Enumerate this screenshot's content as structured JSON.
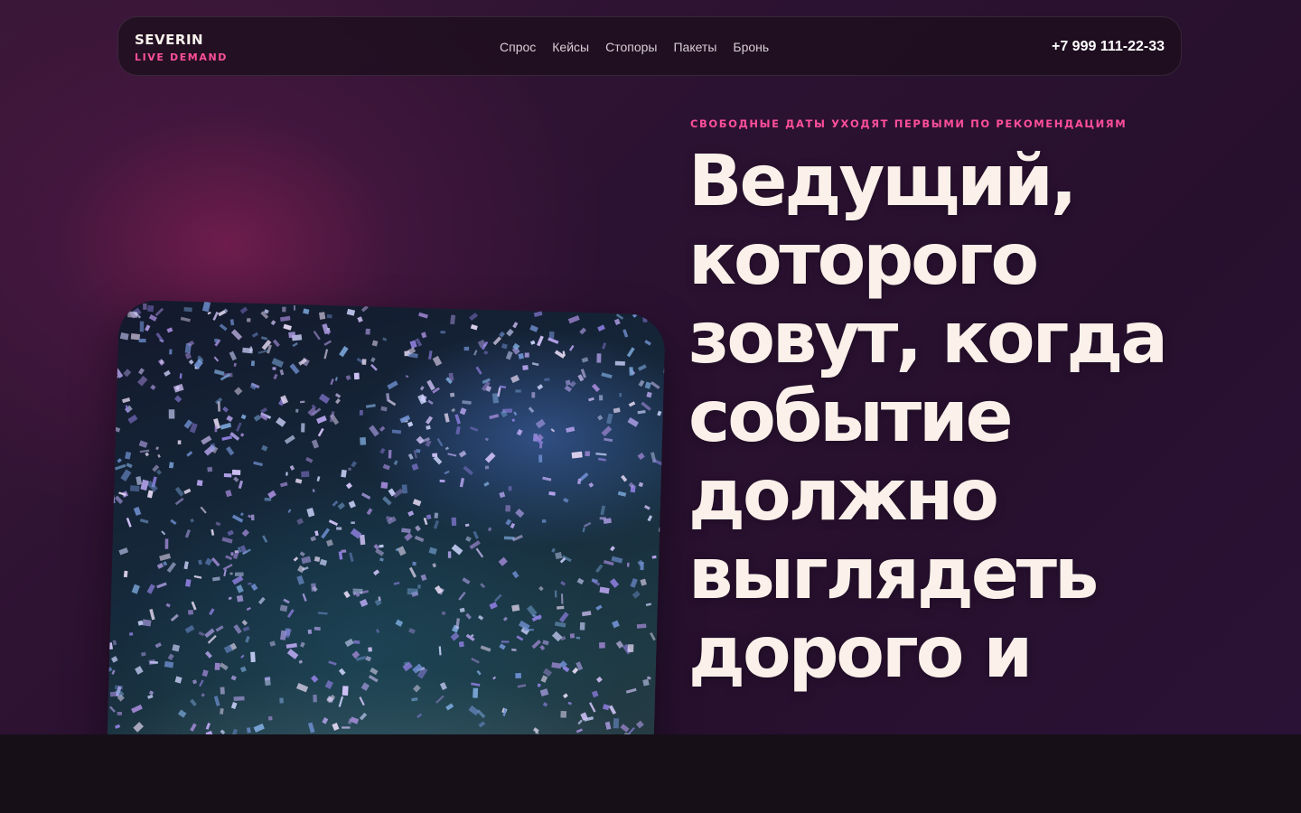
{
  "brand": {
    "name": "SEVERIN",
    "tagline": "LIVE DEMAND"
  },
  "nav": {
    "items": [
      {
        "label": "Спрос"
      },
      {
        "label": "Кейсы"
      },
      {
        "label": "Стопоры"
      },
      {
        "label": "Пакеты"
      },
      {
        "label": "Бронь"
      }
    ]
  },
  "contact": {
    "phone": "+7 999 111-22-33"
  },
  "hero": {
    "eyebrow": "СВОБОДНЫЕ ДАТЫ УХОДЯТ ПЕРВЫМИ ПО РЕКОМЕНДАЦИЯМ",
    "headline": "Ведущий, которого зовут, когда событие должно выглядеть дорого и",
    "image_subject": "confetti-photo"
  },
  "colors": {
    "accent": "#ff4f9a",
    "headline": "#fbf1ea",
    "background": "#2a1232",
    "footer_band": "#160f18"
  }
}
